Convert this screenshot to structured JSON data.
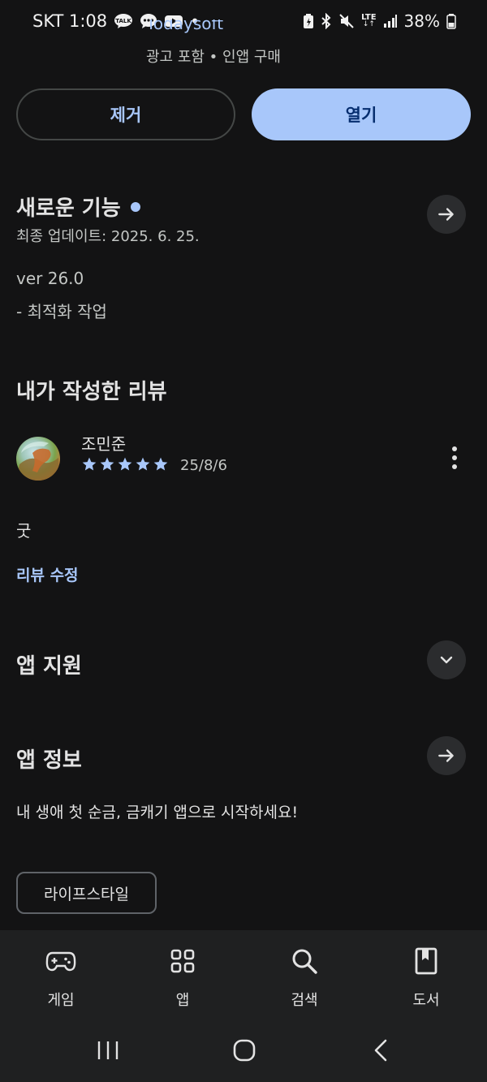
{
  "status_bar": {
    "carrier_time": "SKT 1:08",
    "talk_badge": "TALK",
    "dot": "•",
    "lte": "LTE",
    "battery": "38%"
  },
  "header": {
    "developer_name_partial": "Todaysoft",
    "meta": "광고 포함 • 인앱 구매"
  },
  "actions": {
    "remove_label": "제거",
    "open_label": "열기"
  },
  "whats_new": {
    "title": "새로운 기능",
    "updated": "최종 업데이트: 2025. 6. 25.",
    "version": "ver 26.0",
    "note": "- 최적화 작업"
  },
  "my_review": {
    "title": "내가 작성한 리뷰",
    "author": "조민준",
    "rating": 5,
    "date": "25/8/6",
    "text": "굿",
    "edit_label": "리뷰 수정"
  },
  "app_support": {
    "title": "앱 지원"
  },
  "app_info": {
    "title": "앱 정보",
    "description": "내 생애 첫 순금, 금캐기 앱으로 시작하세요!",
    "category_chip": "라이프스타일"
  },
  "bottom_nav": {
    "items": [
      {
        "label": "게임",
        "icon": "gamepad-icon"
      },
      {
        "label": "앱",
        "icon": "apps-grid-icon"
      },
      {
        "label": "검색",
        "icon": "search-icon"
      },
      {
        "label": "도서",
        "icon": "book-icon"
      }
    ]
  },
  "colors": {
    "background": "#131314",
    "accent": "#a8c7fa",
    "nav_background": "#1f2021"
  }
}
